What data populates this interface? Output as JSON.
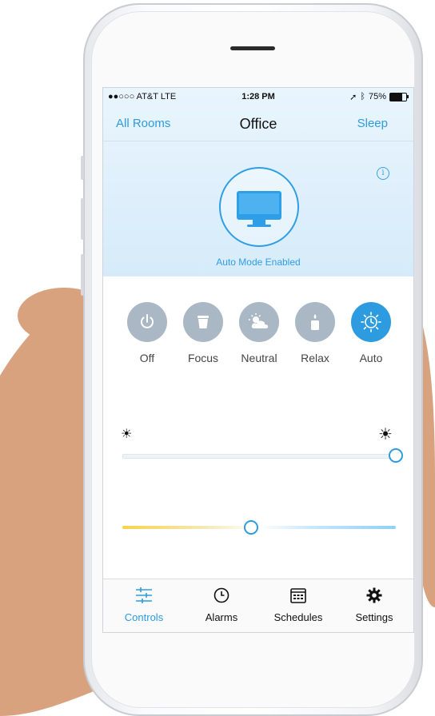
{
  "status_bar": {
    "carrier": "●●○○○ AT&T  LTE",
    "time": "1:28 PM",
    "battery": "75%"
  },
  "nav": {
    "left": "All Rooms",
    "title": "Office",
    "right": "Sleep"
  },
  "hero": {
    "mode_label": "Auto Mode Enabled",
    "info_icon": "i"
  },
  "modes": [
    {
      "label": "Off",
      "icon": "power-icon",
      "active": false
    },
    {
      "label": "Focus",
      "icon": "cup-icon",
      "active": false
    },
    {
      "label": "Neutral",
      "icon": "partly-cloudy-icon",
      "active": false
    },
    {
      "label": "Relax",
      "icon": "candle-icon",
      "active": false
    },
    {
      "label": "Auto",
      "icon": "sun-clock-icon",
      "active": true
    }
  ],
  "sliders": {
    "brightness_label": "",
    "brightness_value": 1.0,
    "temperature_value": 0.47
  },
  "tabs": [
    {
      "label": "Controls",
      "icon": "sliders-icon",
      "active": true
    },
    {
      "label": "Alarms",
      "icon": "clock-icon",
      "active": false
    },
    {
      "label": "Schedules",
      "icon": "calendar-icon",
      "active": false
    },
    {
      "label": "Settings",
      "icon": "gear-icon",
      "active": false
    }
  ],
  "colors": {
    "accent": "#2d9be0",
    "mode_inactive": "#a9b8c4",
    "warm": "#f7d24a",
    "cool": "#8fd0f7"
  }
}
